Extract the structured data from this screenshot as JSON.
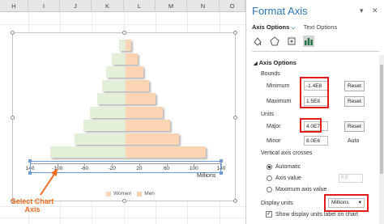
{
  "sheet": {
    "columns": [
      "H",
      "I",
      "J",
      "K",
      "L",
      "M",
      "N",
      "O"
    ]
  },
  "chart": {
    "axis_ticks": [
      "140",
      "-100",
      "-60",
      "-20",
      "20",
      "60",
      "100",
      "140"
    ],
    "units_label": "Millions",
    "legend": [
      {
        "name": "Women",
        "color": "#e4efda"
      },
      {
        "name": "Men",
        "color": "#fbd4b4"
      }
    ],
    "callout": "Select Chart\nAxis",
    "callout_color": "#f26b21"
  },
  "chart_data": {
    "type": "bar",
    "orientation": "horizontal",
    "xlabel": "Millions",
    "xlim": [
      -140,
      140
    ],
    "tick_labels": [
      "140",
      "-100",
      "-60",
      "-20",
      "20",
      "60",
      "100",
      "140"
    ],
    "series": [
      {
        "name": "Women",
        "values": [
          -10,
          -20,
          -28,
          -34,
          -42,
          -52,
          -62,
          -75,
          -110
        ]
      },
      {
        "name": "Men",
        "values": [
          8,
          18,
          26,
          34,
          44,
          55,
          65,
          78,
          118
        ]
      }
    ],
    "legend_position": "bottom"
  },
  "pane": {
    "title": "Format Axis",
    "dropdown_glyph": "▾",
    "close_glyph": "✕",
    "tab_axis_options": "Axis Options",
    "tab_chevron": "⌵",
    "tab_text_options": "Text Options",
    "section_title": "Axis Options",
    "section_arrow": "◢",
    "bounds_label": "Bounds",
    "minimum_label": "Minimum",
    "minimum_value": "-1.4E8",
    "maximum_label": "Maximum",
    "maximum_value": "1.5E8",
    "reset_label": "Reset",
    "units_label": "Units",
    "major_label": "Major",
    "major_value": "4.0E7",
    "minor_label": "Minor",
    "minor_value": "8.0E6",
    "auto_label": "Auto",
    "vertical_crosses_label": "Vertical axis crosses",
    "automatic_label": "Automatic",
    "axis_value_label": "Axis value",
    "axis_value_placeholder": "0.0",
    "maximum_axis_value_label": "Maximum axis value",
    "display_units_label": "Display units",
    "display_units_value": "Millions",
    "show_units_label": "Show display units label on chart",
    "highlight_color": "#e31b1b",
    "accent_color": "#2e75b6"
  }
}
